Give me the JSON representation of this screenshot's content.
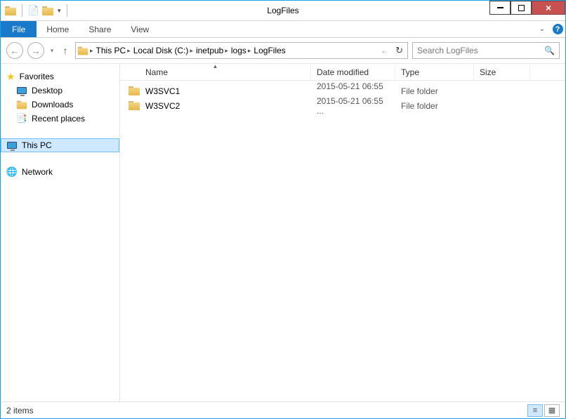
{
  "window": {
    "title": "LogFiles"
  },
  "ribbon": {
    "file": "File",
    "tabs": [
      "Home",
      "Share",
      "View"
    ]
  },
  "breadcrumb": {
    "items": [
      "This PC",
      "Local Disk (C:)",
      "inetpub",
      "logs",
      "LogFiles"
    ]
  },
  "search": {
    "placeholder": "Search LogFiles"
  },
  "sidebar": {
    "favorites": {
      "label": "Favorites",
      "items": [
        {
          "label": "Desktop"
        },
        {
          "label": "Downloads"
        },
        {
          "label": "Recent places"
        }
      ]
    },
    "thispc": {
      "label": "This PC"
    },
    "network": {
      "label": "Network"
    }
  },
  "columns": {
    "name": "Name",
    "date": "Date modified",
    "type": "Type",
    "size": "Size"
  },
  "rows": [
    {
      "name": "W3SVC1",
      "date": "2015-05-21 06:55 ...",
      "type": "File folder",
      "size": ""
    },
    {
      "name": "W3SVC2",
      "date": "2015-05-21 06:55 ...",
      "type": "File folder",
      "size": ""
    }
  ],
  "status": {
    "text": "2 items"
  }
}
